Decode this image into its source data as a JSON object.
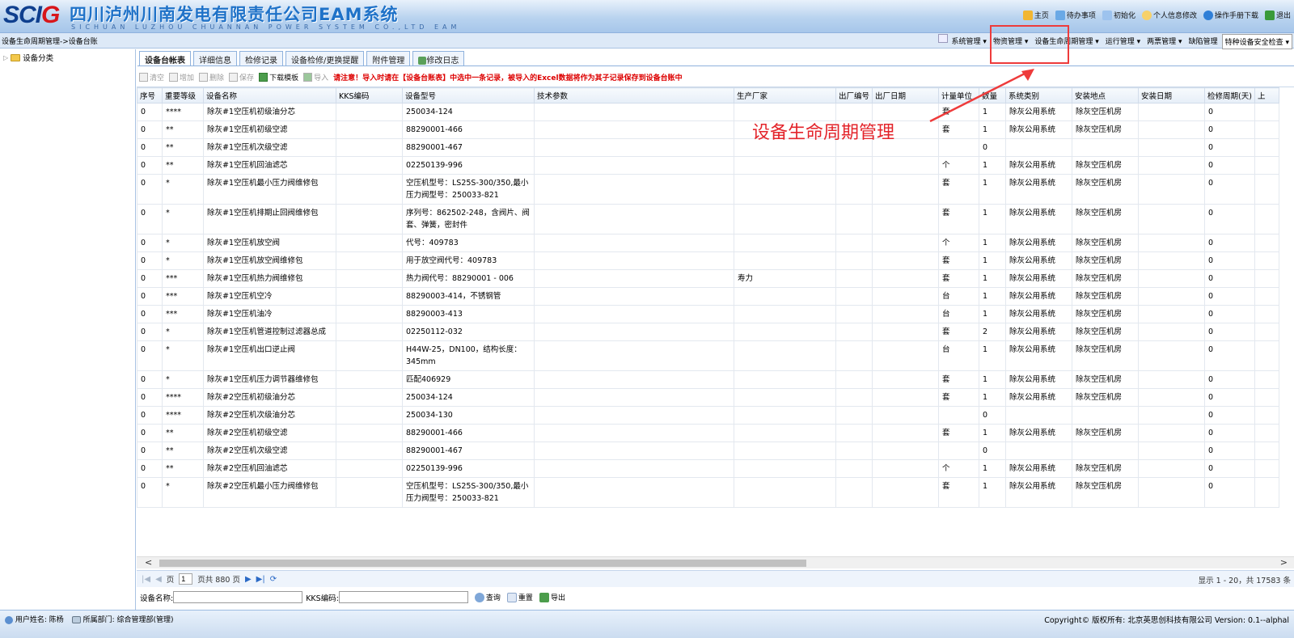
{
  "header": {
    "logo_main": "SCI",
    "logo_accent": "G",
    "company_name": "四川泸州川南发电有限责任公司EAM系统",
    "company_en": "SICHUAN LUZHOU CHUANNAN POWER SYSTEM CO.,LTD EAM",
    "links": [
      "主页",
      "待办事项",
      "初始化",
      "个人信息修改",
      "操作手册下载",
      "退出"
    ]
  },
  "breadcrumb": "设备生命周期管理->设备台账",
  "menu": [
    "系统管理",
    "物资管理",
    "设备生命周期管理",
    "运行管理",
    "两票管理",
    "缺陷管理",
    "特种设备安全检查"
  ],
  "tree": {
    "root_label": "设备分类"
  },
  "tabs": [
    "设备台帐表",
    "详细信息",
    "检修记录",
    "设备检修/更换提醒",
    "附件管理",
    "修改日志"
  ],
  "toolbar": {
    "buttons": [
      "清空",
      "增加",
      "删除",
      "保存",
      "下载模板",
      "导入"
    ],
    "notice": "请注意！导入时请在【设备台账表】中选中一条记录，被导入的Excel数据将作为其子记录保存到设备台账中"
  },
  "table": {
    "columns": [
      "序号",
      "重要等级",
      "设备名称",
      "KKS编码",
      "设备型号",
      "技术参数",
      "生产厂家",
      "出厂编号",
      "出厂日期",
      "计量单位",
      "数量",
      "系统类别",
      "安装地点",
      "安装日期",
      "检修周期(天)",
      "上"
    ],
    "rows": [
      [
        "0",
        "****",
        "除灰#1空压机初级油分芯",
        "",
        "250034-124",
        "",
        "",
        "",
        "",
        "套",
        "1",
        "除灰公用系统",
        "除灰空压机房",
        "",
        "0"
      ],
      [
        "0",
        "**",
        "除灰#1空压机初级空滤",
        "",
        "88290001-466",
        "",
        "",
        "",
        "",
        "套",
        "1",
        "除灰公用系统",
        "除灰空压机房",
        "",
        "0"
      ],
      [
        "0",
        "**",
        "除灰#1空压机次级空滤",
        "",
        "88290001-467",
        "",
        "",
        "",
        "",
        "",
        "0",
        "",
        "",
        "",
        "0"
      ],
      [
        "0",
        "**",
        "除灰#1空压机回油滤芯",
        "",
        "02250139-996",
        "",
        "",
        "",
        "",
        "个",
        "1",
        "除灰公用系统",
        "除灰空压机房",
        "",
        "0"
      ],
      [
        "0",
        "*",
        "除灰#1空压机最小压力阀维修包",
        "",
        "空压机型号：LS25S-300/350,最小压力阀型号：250033-821",
        "",
        "",
        "",
        "",
        "套",
        "1",
        "除灰公用系统",
        "除灰空压机房",
        "",
        "0"
      ],
      [
        "0",
        "*",
        "除灰#1空压机排期止回阀维修包",
        "",
        "序列号：862502-248，含阀片、阀套、弹簧，密封件",
        "",
        "",
        "",
        "",
        "套",
        "1",
        "除灰公用系统",
        "除灰空压机房",
        "",
        "0"
      ],
      [
        "0",
        "*",
        "除灰#1空压机放空阀",
        "",
        "代号：409783",
        "",
        "",
        "",
        "",
        "个",
        "1",
        "除灰公用系统",
        "除灰空压机房",
        "",
        "0"
      ],
      [
        "0",
        "*",
        "除灰#1空压机放空阀维修包",
        "",
        "用于放空阀代号：409783",
        "",
        "",
        "",
        "",
        "套",
        "1",
        "除灰公用系统",
        "除灰空压机房",
        "",
        "0"
      ],
      [
        "0",
        "***",
        "除灰#1空压机热力阀维修包",
        "",
        "热力阀代号：88290001 - 006",
        "",
        "寿力",
        "",
        "",
        "套",
        "1",
        "除灰公用系统",
        "除灰空压机房",
        "",
        "0"
      ],
      [
        "0",
        "***",
        "除灰#1空压机空冷",
        "",
        "88290003-414，不锈钢管",
        "",
        "",
        "",
        "",
        "台",
        "1",
        "除灰公用系统",
        "除灰空压机房",
        "",
        "0"
      ],
      [
        "0",
        "***",
        "除灰#1空压机油冷",
        "",
        "88290003-413",
        "",
        "",
        "",
        "",
        "台",
        "1",
        "除灰公用系统",
        "除灰空压机房",
        "",
        "0"
      ],
      [
        "0",
        "*",
        "除灰#1空压机管道控制过滤器总成",
        "",
        "02250112-032",
        "",
        "",
        "",
        "",
        "套",
        "2",
        "除灰公用系统",
        "除灰空压机房",
        "",
        "0"
      ],
      [
        "0",
        "*",
        "除灰#1空压机出口逆止阀",
        "",
        "H44W-25，DN100，结构长度：345mm",
        "",
        "",
        "",
        "",
        "台",
        "1",
        "除灰公用系统",
        "除灰空压机房",
        "",
        "0"
      ],
      [
        "0",
        "*",
        "除灰#1空压机压力调节器维修包",
        "",
        "匹配406929",
        "",
        "",
        "",
        "",
        "套",
        "1",
        "除灰公用系统",
        "除灰空压机房",
        "",
        "0"
      ],
      [
        "0",
        "****",
        "除灰#2空压机初级油分芯",
        "",
        "250034-124",
        "",
        "",
        "",
        "",
        "套",
        "1",
        "除灰公用系统",
        "除灰空压机房",
        "",
        "0"
      ],
      [
        "0",
        "****",
        "除灰#2空压机次级油分芯",
        "",
        "250034-130",
        "",
        "",
        "",
        "",
        "",
        "0",
        "",
        "",
        "",
        "0"
      ],
      [
        "0",
        "**",
        "除灰#2空压机初级空滤",
        "",
        "88290001-466",
        "",
        "",
        "",
        "",
        "套",
        "1",
        "除灰公用系统",
        "除灰空压机房",
        "",
        "0"
      ],
      [
        "0",
        "**",
        "除灰#2空压机次级空滤",
        "",
        "88290001-467",
        "",
        "",
        "",
        "",
        "",
        "0",
        "",
        "",
        "",
        "0"
      ],
      [
        "0",
        "**",
        "除灰#2空压机回油滤芯",
        "",
        "02250139-996",
        "",
        "",
        "",
        "",
        "个",
        "1",
        "除灰公用系统",
        "除灰空压机房",
        "",
        "0"
      ],
      [
        "0",
        "*",
        "除灰#2空压机最小压力阀维修包",
        "",
        "空压机型号：LS25S-300/350,最小压力阀型号：250033-821",
        "",
        "",
        "",
        "",
        "套",
        "1",
        "除灰公用系统",
        "除灰空压机房",
        "",
        "0"
      ]
    ]
  },
  "annotation": {
    "text": "设备生命周期管理"
  },
  "pager": {
    "page_prefix": "页",
    "page_value": "1",
    "page_suffix": "页共 880 页",
    "summary": "显示 1 - 20，共 17583 条"
  },
  "search": {
    "name_label": "设备名称:",
    "kks_label": "KKS编码:",
    "query_button": "查询",
    "reset_button": "重置",
    "export_button": "导出"
  },
  "status": {
    "user": "用户姓名: 陈杨",
    "dept": "所属部门: 综合管理部(管理)",
    "copyright": "Copyright© 版权所有: 北京英思创科技有限公司  Version: 0.1--alphal"
  },
  "colors": {
    "accent_red": "#e3242b",
    "brand_blue": "#1f72c8"
  }
}
